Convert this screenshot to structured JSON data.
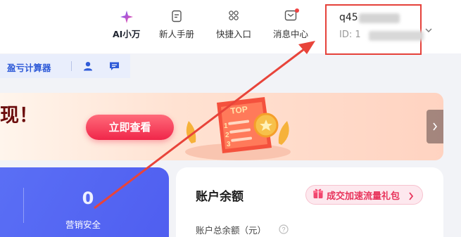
{
  "header": {
    "nav": [
      {
        "label": "AI小万",
        "icon": "sparkle-icon"
      },
      {
        "label": "新人手册",
        "icon": "document-icon"
      },
      {
        "label": "快捷入口",
        "icon": "grid-icon"
      },
      {
        "label": "消息中心",
        "icon": "mail-icon"
      }
    ],
    "account": {
      "name_prefix": "q45",
      "id_prefix": "ID: 1"
    }
  },
  "tools": {
    "calculator_label": "盈亏计算器"
  },
  "banner": {
    "headline": "现！",
    "cta_label": "立即查看",
    "badge_text": "TOP"
  },
  "stat": {
    "value": "0",
    "label": "营销安全"
  },
  "balance": {
    "title": "账户余额",
    "promo_label": "成交加速流量礼包",
    "total_label": "账户总余额（元）"
  },
  "colors": {
    "accent_blue": "#4f5ef0",
    "cta_red": "#f0264a",
    "highlight_red": "#e5413a"
  }
}
